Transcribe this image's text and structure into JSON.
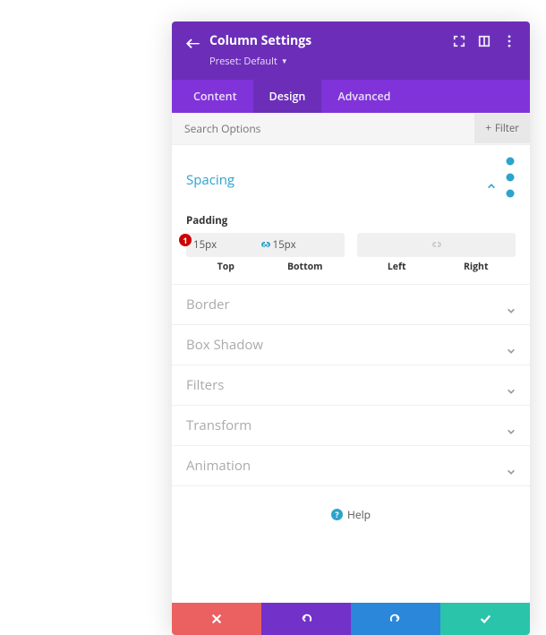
{
  "header": {
    "title": "Column Settings",
    "preset_label": "Preset: Default"
  },
  "tabs": [
    {
      "label": "Content",
      "active": false
    },
    {
      "label": "Design",
      "active": true
    },
    {
      "label": "Advanced",
      "active": false
    }
  ],
  "search": {
    "placeholder": "Search Options",
    "filter_label": "Filter"
  },
  "sections": {
    "spacing": {
      "title": "Spacing"
    },
    "border": {
      "title": "Border"
    },
    "box_shadow": {
      "title": "Box Shadow"
    },
    "filters": {
      "title": "Filters"
    },
    "transform": {
      "title": "Transform"
    },
    "animation": {
      "title": "Animation"
    }
  },
  "spacing": {
    "padding_label": "Padding",
    "top": {
      "value": "15px",
      "label": "Top"
    },
    "bottom": {
      "value": "15px",
      "label": "Bottom"
    },
    "left": {
      "value": "",
      "label": "Left"
    },
    "right": {
      "value": "",
      "label": "Right"
    }
  },
  "marker": "1",
  "help": {
    "label": "Help"
  }
}
